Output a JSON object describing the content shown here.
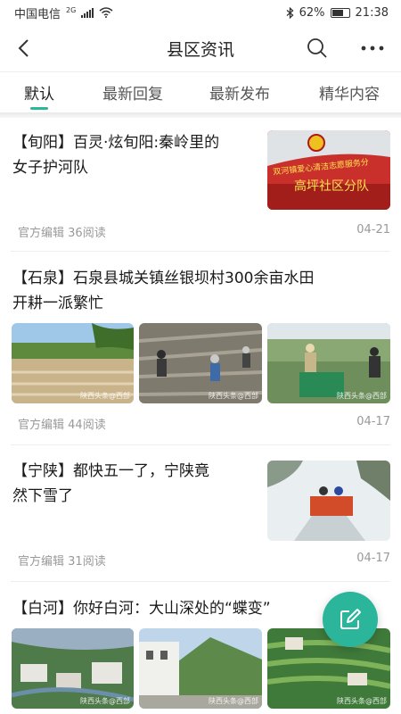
{
  "status_bar": {
    "carrier": "中国电信",
    "network": "2G",
    "battery": "62%",
    "time": "21:38"
  },
  "header": {
    "title": "县区资讯",
    "back_icon": "chevron-left-icon",
    "search_icon": "search-icon",
    "more_icon": "more-icon"
  },
  "tabs": [
    {
      "label": "默认",
      "active": true
    },
    {
      "label": "最新回复",
      "active": false
    },
    {
      "label": "最新发布",
      "active": false
    },
    {
      "label": "精华内容",
      "active": false
    }
  ],
  "articles": [
    {
      "title_line1": "【旬阳】百灵·炫旬阳:秦岭里的",
      "title_line2": "女子护河队",
      "banner_text": "双河镇爱心清洁志愿服务分",
      "banner_text2": "高坪社区分队",
      "author": "官方编辑",
      "reads": "36阅读",
      "date": "04-21"
    },
    {
      "title_line1": "【石泉】石泉县城关镇丝银坝村300余亩水田",
      "title_line2": "开耕一派繁忙",
      "watermark": "陕西头条@西部",
      "author": "官方编辑",
      "reads": "44阅读",
      "date": "04-17"
    },
    {
      "title_line1": "【宁陕】都快五一了，宁陕竟",
      "title_line2": "然下雪了",
      "author": "官方编辑",
      "reads": "31阅读",
      "date": "04-17"
    },
    {
      "title_line1": "【白河】你好白河：大山深处的“蝶变”",
      "watermark": "陕西头条@西部"
    }
  ],
  "fab": {
    "icon": "edit-icon"
  },
  "colors": {
    "accent": "#2bb59a"
  }
}
